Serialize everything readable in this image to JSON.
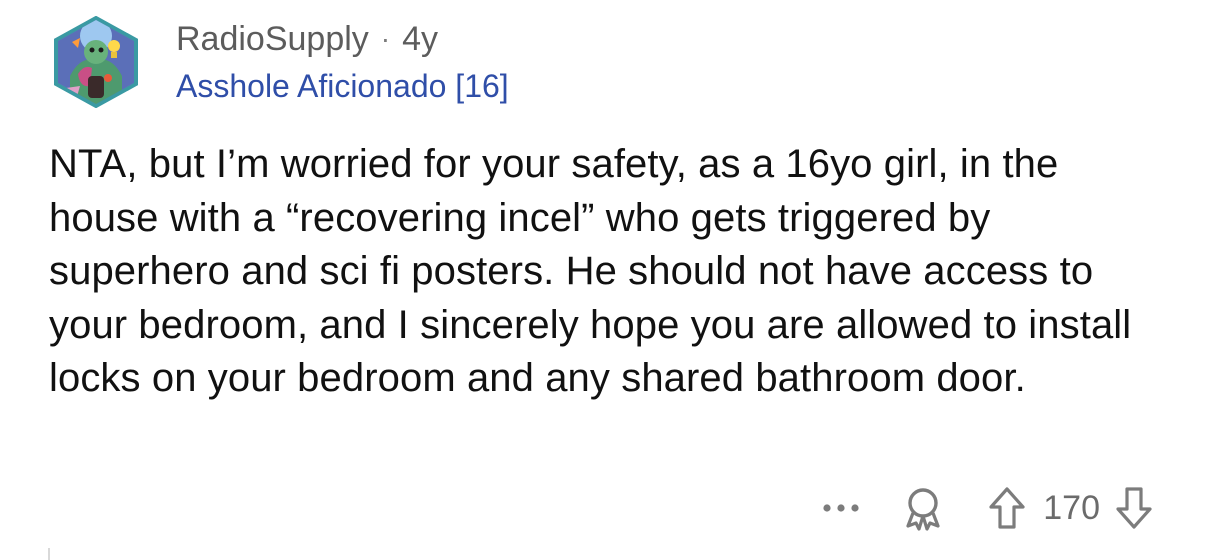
{
  "comment": {
    "author": {
      "username": "RadioSupply",
      "separator": "·",
      "age": "4y",
      "flair": "Asshole Aficionado [16]",
      "avatar_icon": "snoo-avatar-icon"
    },
    "body": "NTA, but I’m worried for your safety, as a 16yo girl, in the house with a “recovering incel” who gets triggered by superhero and sci fi posters. He should not have access to your bedroom, and I sincerely hope you are allowed to install locks on your bedroom and any shared bathroom door.",
    "actions": {
      "more_icon": "more-options-icon",
      "award_icon": "award-icon",
      "upvote_icon": "upvote-arrow-icon",
      "score": "170",
      "downvote_icon": "downvote-arrow-icon"
    }
  },
  "colors": {
    "flair": "#2f4ea8",
    "meta_text": "#5c5c5c",
    "body_text": "#111111",
    "icon_gray": "#7c7c7c"
  }
}
